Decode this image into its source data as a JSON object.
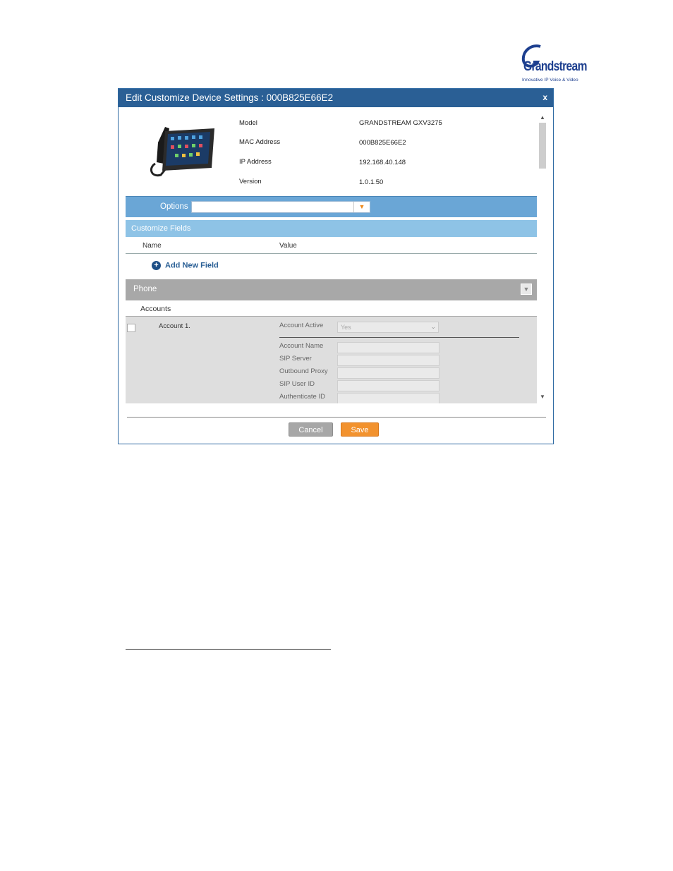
{
  "logo": {
    "brand": "Grandstream",
    "tagline": "Innovative IP Voice & Video"
  },
  "dialog": {
    "title": "Edit Customize Device Settings : 000B825E66E2",
    "close_label": "x"
  },
  "device": {
    "fields": [
      {
        "label": "Model",
        "value": "GRANDSTREAM GXV3275"
      },
      {
        "label": "MAC Address",
        "value": "000B825E66E2"
      },
      {
        "label": "IP Address",
        "value": "192.168.40.148"
      },
      {
        "label": "Version",
        "value": "1.0.1.50"
      }
    ]
  },
  "options": {
    "label": "Options",
    "value": ""
  },
  "customize": {
    "title": "Customize Fields",
    "col_name": "Name",
    "col_value": "Value",
    "add_label": "Add New Field"
  },
  "phone": {
    "title": "Phone",
    "accounts_label": "Accounts"
  },
  "account": {
    "name": "Account 1.",
    "active_label": "Account Active",
    "active_value": "Yes",
    "fields": [
      "Account Name",
      "SIP Server",
      "Outbound Proxy",
      "SIP User ID",
      "Authenticate ID"
    ]
  },
  "buttons": {
    "cancel": "Cancel",
    "save": "Save"
  },
  "colors": {
    "title_bar": "#2a5f95",
    "options_bar": "#6aa6d6",
    "save": "#f2922e"
  }
}
